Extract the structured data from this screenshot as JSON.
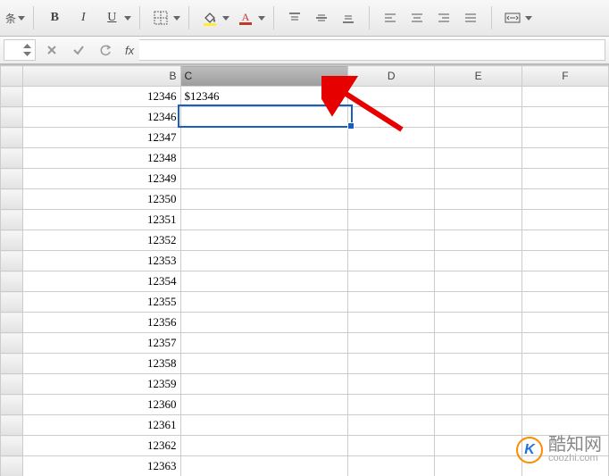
{
  "toolbar": {
    "bold": "B",
    "italic": "I",
    "underline": "U"
  },
  "columns": [
    "B",
    "C",
    "D",
    "E",
    "F"
  ],
  "selected_column": "C",
  "selected_cell": "C2",
  "cells": {
    "B": [
      "12346",
      "12346",
      "12347",
      "12348",
      "12349",
      "12350",
      "12351",
      "12352",
      "12353",
      "12354",
      "12355",
      "12356",
      "12357",
      "12358",
      "12359",
      "12360",
      "12361",
      "12362",
      "12363"
    ],
    "C": [
      "$12346",
      "",
      "",
      "",
      "",
      "",
      "",
      "",
      "",
      "",
      "",
      "",
      "",
      "",
      "",
      "",
      "",
      "",
      ""
    ]
  },
  "watermark": {
    "brand": "K",
    "text": "酷知网",
    "domain": "coozhi.com"
  }
}
